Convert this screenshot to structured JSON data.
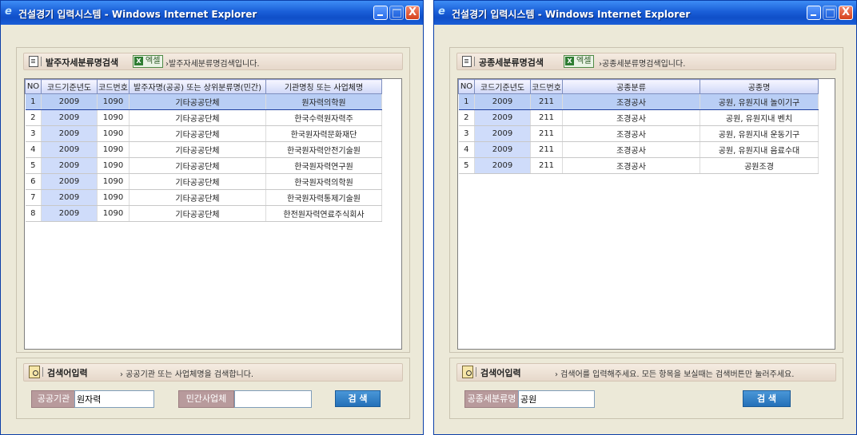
{
  "left": {
    "window_title": "건설경기 입력시스템 - Windows Internet Explorer",
    "section_title": "발주자세분류명검색",
    "excel_label": "엑셀",
    "section_desc": "›발주자세분류명검색입니다.",
    "columns": [
      "NO",
      "코드기준년도",
      "코드번호",
      "발주자명(공공) 또는 상위분류명(민간)",
      "기관명칭 또는 사업체명"
    ],
    "rows": [
      [
        "1",
        "2009",
        "1090",
        "기타공공단체",
        "원자력의학원"
      ],
      [
        "2",
        "2009",
        "1090",
        "기타공공단체",
        "한국수력원자력주"
      ],
      [
        "3",
        "2009",
        "1090",
        "기타공공단체",
        "한국원자력문화재단"
      ],
      [
        "4",
        "2009",
        "1090",
        "기타공공단체",
        "한국원자력안전기술원"
      ],
      [
        "5",
        "2009",
        "1090",
        "기타공공단체",
        "한국원자력연구원"
      ],
      [
        "6",
        "2009",
        "1090",
        "기타공공단체",
        "한국원자력의학원"
      ],
      [
        "7",
        "2009",
        "1090",
        "기타공공단체",
        "한국원자력통제기술원"
      ],
      [
        "8",
        "2009",
        "1090",
        "기타공공단체",
        "한전원자력연료주식회사"
      ]
    ],
    "input_title": "검색어입력",
    "input_desc": "› 공공기관 또는 사업체명을 검색합니다.",
    "field1_label": "공공기관",
    "field1_value": "원자력",
    "field2_label": "민간사업체",
    "field2_value": "",
    "search_label": "검 색"
  },
  "right": {
    "window_title": "건설경기 입력시스템 - Windows Internet Explorer",
    "section_title": "공종세분류명검색",
    "excel_label": "엑셀",
    "section_desc": "›공종세분류명검색입니다.",
    "columns": [
      "NO",
      "코드기준년도",
      "코드번호",
      "공종분류",
      "공종명"
    ],
    "rows": [
      [
        "1",
        "2009",
        "211",
        "조경공사",
        "공원, 유원지내 놀이기구"
      ],
      [
        "2",
        "2009",
        "211",
        "조경공사",
        "공원, 유원지내 벤치"
      ],
      [
        "3",
        "2009",
        "211",
        "조경공사",
        "공원, 유원지내 운동기구"
      ],
      [
        "4",
        "2009",
        "211",
        "조경공사",
        "공원, 유원지내 음료수대"
      ],
      [
        "5",
        "2009",
        "211",
        "조경공사",
        "공원조경"
      ]
    ],
    "input_title": "검색어입력",
    "input_desc": "› 검색어를 입력해주세요. 모든 항목을 보실때는 검색버튼만 눌러주세요.",
    "field1_label": "공종세분류명",
    "field1_value": "공원",
    "search_label": "검 색"
  },
  "colors": {
    "titlebar": "#1a5fd8",
    "selected_row": "#b9cef5",
    "code_cell_tint": "#cfdcfa",
    "search_button": "#2470b8",
    "field_label": "#b89a9c"
  },
  "icons": [
    "ie-logo-icon",
    "minimize-icon",
    "maximize-icon",
    "close-icon",
    "page-icon",
    "excel-icon",
    "search-page-icon"
  ]
}
